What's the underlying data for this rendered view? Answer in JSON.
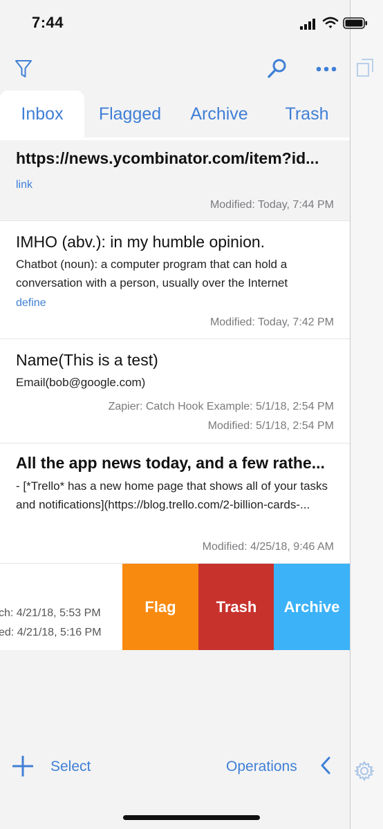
{
  "status_bar": {
    "time": "7:44"
  },
  "tabs": [
    {
      "label": "Inbox",
      "active": true
    },
    {
      "label": "Flagged",
      "active": false
    },
    {
      "label": "Archive",
      "active": false
    },
    {
      "label": "Trash",
      "active": false
    }
  ],
  "notes": [
    {
      "title": "https://news.ycombinator.com/item?id...",
      "tag": "link",
      "modified": "Modified: Today, 7:44 PM"
    },
    {
      "title": "IMHO (abv.): in my humble opinion.",
      "body": "Chatbot (noun): a computer program that can hold a conversation with a person, usually over the Internet",
      "tag": "define",
      "modified": "Modified: Today, 7:42 PM"
    },
    {
      "title": "Name(This is a test)",
      "body": "Email(bob@google.com)",
      "source": "Zapier: Catch Hook Example: 5/1/18, 2:54 PM",
      "modified": "Modified: 5/1/18, 2:54 PM"
    },
    {
      "title": "All the app news today, and a few rathe...",
      "body": "- [*Trello* has a new home page that shows all of your tasks and notifications](https://blog.trello.com/2-billion-cards-...",
      "modified": "Modified: 4/25/18, 9:46 AM"
    }
  ],
  "swiped_note": {
    "line1": "ch: 4/21/18, 5:53 PM",
    "line2": "ed: 4/21/18, 5:16 PM",
    "actions": {
      "flag": "Flag",
      "trash": "Trash",
      "archive": "Archive"
    }
  },
  "bottom_bar": {
    "select": "Select",
    "operations": "Operations"
  },
  "colors": {
    "accent": "#3f7fd6",
    "flag": "#f98a10",
    "trash": "#c8322d",
    "archive": "#3cb2f8"
  }
}
